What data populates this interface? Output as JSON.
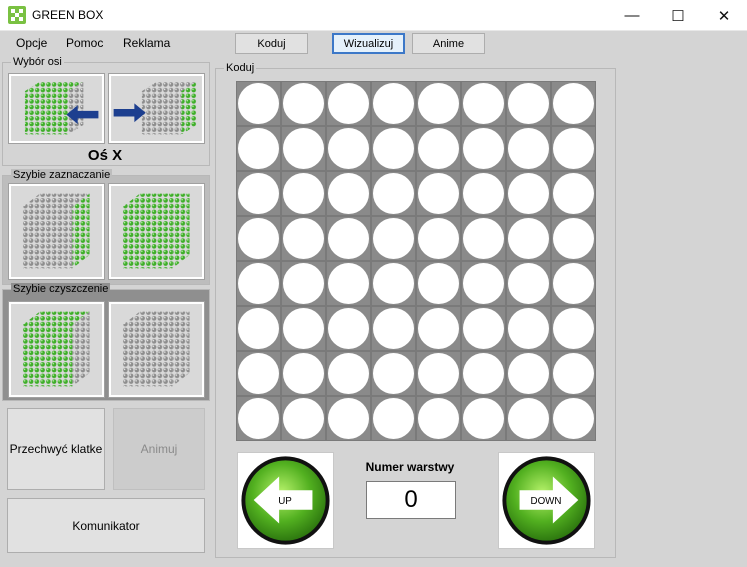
{
  "window": {
    "title": "GREEN BOX",
    "controls": [
      "—",
      "☐",
      "✕"
    ]
  },
  "menu": [
    "Opcje",
    "Pomoc",
    "Reklama"
  ],
  "tabs": [
    {
      "label": "Koduj",
      "active": false
    },
    {
      "label": "Wizualizuj",
      "active": true
    },
    {
      "label": "Anime",
      "active": false
    }
  ],
  "axis_panel": {
    "title": "Wybór osi",
    "selected_axis": "Oś X"
  },
  "quick_select": {
    "title": "Szybie zaznaczanie"
  },
  "quick_clear": {
    "title": "Szybie czyszczenie"
  },
  "buttons": {
    "capture": "Przechwyć klatke",
    "animate": "Animuj",
    "communicator": "Komunikator"
  },
  "main": {
    "title": "Koduj",
    "grid_rows": 8,
    "grid_cols": 8,
    "layer_label": "Numer warstwy",
    "layer_value": "0",
    "up_label": "UP",
    "down_label": "DOWN"
  },
  "colors": {
    "accent_green": "#7ac142",
    "arrow_green": "#52b020",
    "led_off": "#ffffff",
    "active_tab_border": "#3c78c8"
  }
}
